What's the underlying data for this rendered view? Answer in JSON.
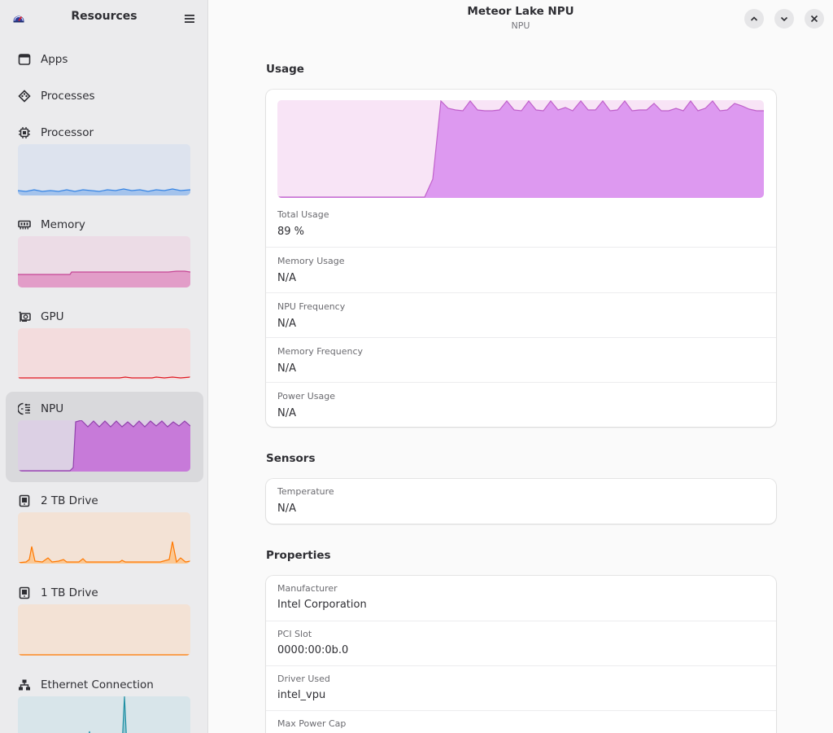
{
  "sidebar": {
    "title": "Resources",
    "items": [
      {
        "label": "Apps",
        "icon": "window-icon"
      },
      {
        "label": "Processes",
        "icon": "processes-icon"
      },
      {
        "label": "Processor",
        "icon": "cpu-icon",
        "color": "#3584e4",
        "bg": "#dde3ee"
      },
      {
        "label": "Memory",
        "icon": "memory-icon",
        "color": "#c64595",
        "bg": "#ecdce6"
      },
      {
        "label": "GPU",
        "icon": "gpu-icon",
        "color": "#e01b24",
        "bg": "#f3dcdd"
      },
      {
        "label": "NPU",
        "icon": "npu-icon",
        "color": "#9141ac",
        "bg": "#dcd0e4"
      },
      {
        "label": "2 TB Drive",
        "icon": "drive-icon",
        "color": "#ff7800",
        "bg": "#f3e2d5"
      },
      {
        "label": "1 TB Drive",
        "icon": "drive-icon",
        "color": "#ff7800",
        "bg": "#f3e2d5"
      },
      {
        "label": "Ethernet Connection",
        "icon": "network-icon",
        "color": "#2190a4",
        "bg": "#d8e5ea"
      }
    ]
  },
  "header": {
    "title": "Meteor Lake NPU",
    "subtitle": "NPU"
  },
  "usage": {
    "section_title": "Usage",
    "color": "#c061cb",
    "rows": [
      {
        "label": "Total Usage",
        "value": "89 %"
      },
      {
        "label": "Memory Usage",
        "value": "N/A"
      },
      {
        "label": "NPU Frequency",
        "value": "N/A"
      },
      {
        "label": "Memory Frequency",
        "value": "N/A"
      },
      {
        "label": "Power Usage",
        "value": "N/A"
      }
    ]
  },
  "sensors": {
    "section_title": "Sensors",
    "rows": [
      {
        "label": "Temperature",
        "value": "N/A"
      }
    ]
  },
  "properties": {
    "section_title": "Properties",
    "rows": [
      {
        "label": "Manufacturer",
        "value": "Intel Corporation"
      },
      {
        "label": "PCI Slot",
        "value": "0000:00:0b.0"
      },
      {
        "label": "Driver Used",
        "value": "intel_vpu"
      },
      {
        "label": "Max Power Cap",
        "value": ""
      }
    ]
  }
}
